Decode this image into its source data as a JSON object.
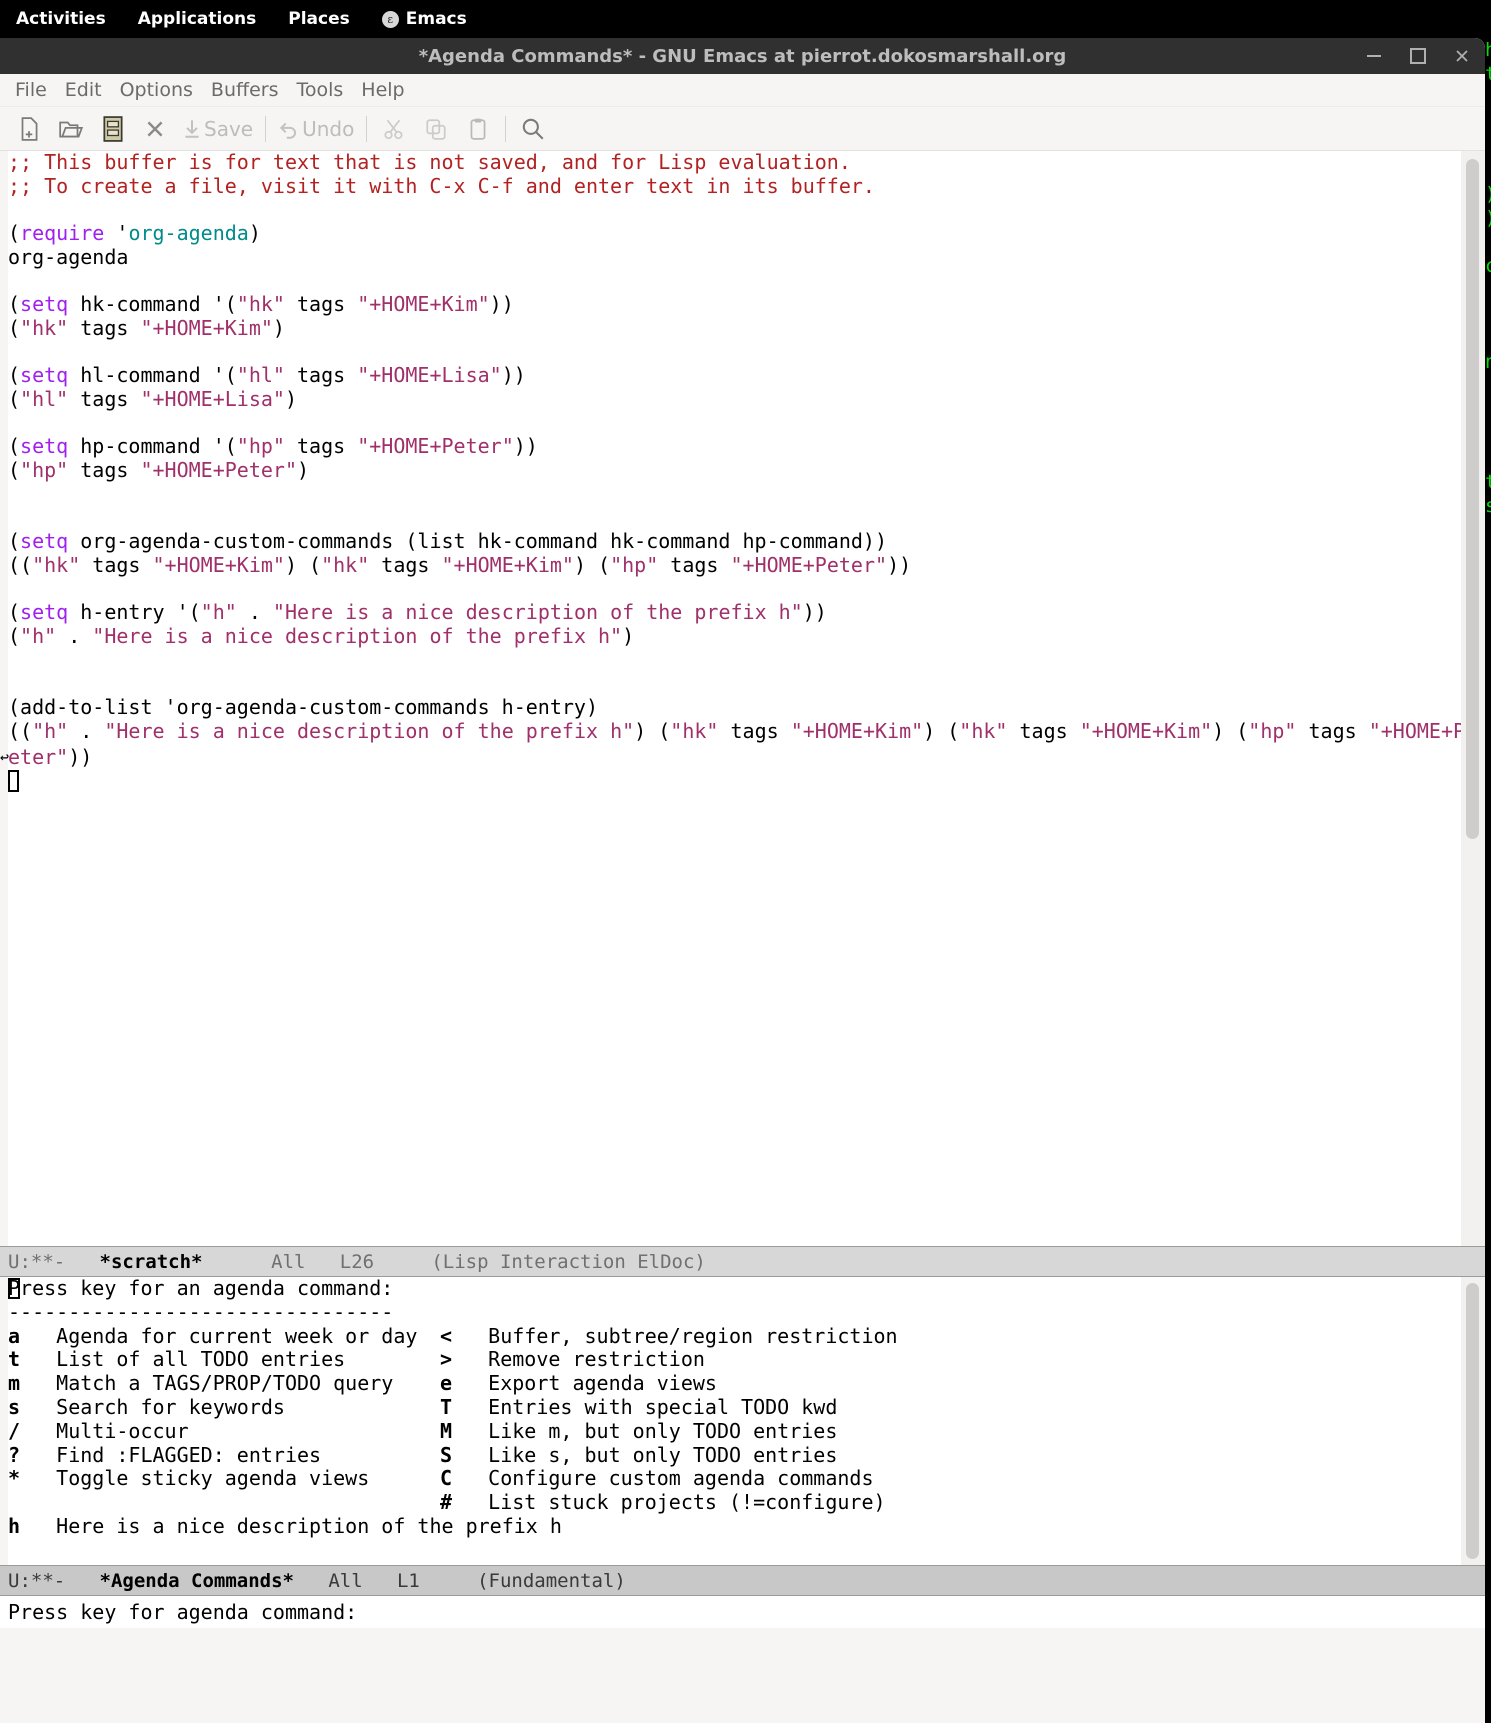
{
  "desktop": {
    "activities": "Activities",
    "applications": "Applications",
    "places": "Places",
    "app_name": "Emacs",
    "app_logo_glyph": "ε"
  },
  "window": {
    "title": "*Agenda Commands* - GNU Emacs at pierrot.dokosmarshall.org",
    "minimize": "—",
    "maximize": "□",
    "close": "✕"
  },
  "menubar": {
    "items": [
      "File",
      "Edit",
      "Options",
      "Buffers",
      "Tools",
      "Help"
    ]
  },
  "toolbar": {
    "new_file": "new-file-icon",
    "open_file": "open-folder-icon",
    "dired": "dired-cabinet-icon",
    "close_buffer": "close-x-icon",
    "save_label": "Save",
    "undo_label": "Undo",
    "cut": "scissors-icon",
    "copy": "copy-icon",
    "paste": "clipboard-icon",
    "search": "magnifier-icon"
  },
  "scratch_buffer": {
    "lines": [
      {
        "segs": [
          {
            "t": ";; This buffer is for text that is not saved, and for Lisp evaluation.",
            "c": "c-comment"
          }
        ]
      },
      {
        "segs": [
          {
            "t": ";; To create a file, visit it with C-x C-f and enter text in its buffer.",
            "c": "c-comment"
          }
        ]
      },
      {
        "segs": []
      },
      {
        "segs": [
          {
            "t": "(",
            "c": "c-plain"
          },
          {
            "t": "require",
            "c": "c-kw"
          },
          {
            "t": " '",
            "c": "c-plain"
          },
          {
            "t": "org-agenda",
            "c": "c-const"
          },
          {
            "t": ")",
            "c": "c-plain"
          }
        ]
      },
      {
        "segs": [
          {
            "t": "org-agenda",
            "c": "c-plain"
          }
        ]
      },
      {
        "segs": []
      },
      {
        "segs": [
          {
            "t": "(",
            "c": "c-plain"
          },
          {
            "t": "setq",
            "c": "c-kw"
          },
          {
            "t": " hk-command '(",
            "c": "c-plain"
          },
          {
            "t": "\"hk\"",
            "c": "c-str"
          },
          {
            "t": " tags ",
            "c": "c-plain"
          },
          {
            "t": "\"+HOME+Kim\"",
            "c": "c-str"
          },
          {
            "t": "))",
            "c": "c-plain"
          }
        ]
      },
      {
        "segs": [
          {
            "t": "(",
            "c": "c-plain"
          },
          {
            "t": "\"hk\"",
            "c": "c-str"
          },
          {
            "t": " tags ",
            "c": "c-plain"
          },
          {
            "t": "\"+HOME+Kim\"",
            "c": "c-str"
          },
          {
            "t": ")",
            "c": "c-plain"
          }
        ]
      },
      {
        "segs": []
      },
      {
        "segs": [
          {
            "t": "(",
            "c": "c-plain"
          },
          {
            "t": "setq",
            "c": "c-kw"
          },
          {
            "t": " hl-command '(",
            "c": "c-plain"
          },
          {
            "t": "\"hl\"",
            "c": "c-str"
          },
          {
            "t": " tags ",
            "c": "c-plain"
          },
          {
            "t": "\"+HOME+Lisa\"",
            "c": "c-str"
          },
          {
            "t": "))",
            "c": "c-plain"
          }
        ]
      },
      {
        "segs": [
          {
            "t": "(",
            "c": "c-plain"
          },
          {
            "t": "\"hl\"",
            "c": "c-str"
          },
          {
            "t": " tags ",
            "c": "c-plain"
          },
          {
            "t": "\"+HOME+Lisa\"",
            "c": "c-str"
          },
          {
            "t": ")",
            "c": "c-plain"
          }
        ]
      },
      {
        "segs": []
      },
      {
        "segs": [
          {
            "t": "(",
            "c": "c-plain"
          },
          {
            "t": "setq",
            "c": "c-kw"
          },
          {
            "t": " hp-command '(",
            "c": "c-plain"
          },
          {
            "t": "\"hp\"",
            "c": "c-str"
          },
          {
            "t": " tags ",
            "c": "c-plain"
          },
          {
            "t": "\"+HOME+Peter\"",
            "c": "c-str"
          },
          {
            "t": "))",
            "c": "c-plain"
          }
        ]
      },
      {
        "segs": [
          {
            "t": "(",
            "c": "c-plain"
          },
          {
            "t": "\"hp\"",
            "c": "c-str"
          },
          {
            "t": " tags ",
            "c": "c-plain"
          },
          {
            "t": "\"+HOME+Peter\"",
            "c": "c-str"
          },
          {
            "t": ")",
            "c": "c-plain"
          }
        ]
      },
      {
        "segs": []
      },
      {
        "segs": []
      },
      {
        "segs": [
          {
            "t": "(",
            "c": "c-plain"
          },
          {
            "t": "setq",
            "c": "c-kw"
          },
          {
            "t": " org-agenda-custom-commands (list hk-command hk-command hp-command))",
            "c": "c-plain"
          }
        ]
      },
      {
        "segs": [
          {
            "t": "((",
            "c": "c-plain"
          },
          {
            "t": "\"hk\"",
            "c": "c-str"
          },
          {
            "t": " tags ",
            "c": "c-plain"
          },
          {
            "t": "\"+HOME+Kim\"",
            "c": "c-str"
          },
          {
            "t": ") (",
            "c": "c-plain"
          },
          {
            "t": "\"hk\"",
            "c": "c-str"
          },
          {
            "t": " tags ",
            "c": "c-plain"
          },
          {
            "t": "\"+HOME+Kim\"",
            "c": "c-str"
          },
          {
            "t": ") (",
            "c": "c-plain"
          },
          {
            "t": "\"hp\"",
            "c": "c-str"
          },
          {
            "t": " tags ",
            "c": "c-plain"
          },
          {
            "t": "\"+HOME+Peter\"",
            "c": "c-str"
          },
          {
            "t": "))",
            "c": "c-plain"
          }
        ]
      },
      {
        "segs": []
      },
      {
        "segs": [
          {
            "t": "(",
            "c": "c-plain"
          },
          {
            "t": "setq",
            "c": "c-kw"
          },
          {
            "t": " h-entry '(",
            "c": "c-plain"
          },
          {
            "t": "\"h\"",
            "c": "c-str"
          },
          {
            "t": " . ",
            "c": "c-plain"
          },
          {
            "t": "\"Here is a nice description of the prefix h\"",
            "c": "c-str"
          },
          {
            "t": "))",
            "c": "c-plain"
          }
        ]
      },
      {
        "segs": [
          {
            "t": "(",
            "c": "c-plain"
          },
          {
            "t": "\"h\"",
            "c": "c-str"
          },
          {
            "t": " . ",
            "c": "c-plain"
          },
          {
            "t": "\"Here is a nice description of the prefix h\"",
            "c": "c-str"
          },
          {
            "t": ")",
            "c": "c-plain"
          }
        ]
      },
      {
        "segs": []
      },
      {
        "segs": []
      },
      {
        "segs": [
          {
            "t": "(add-to-list 'org-agenda-custom-commands h-entry)",
            "c": "c-plain"
          }
        ]
      }
    ],
    "wrapped_line": {
      "head": [
        {
          "t": "((",
          "c": "c-plain"
        },
        {
          "t": "\"h\"",
          "c": "c-str"
        },
        {
          "t": " . ",
          "c": "c-plain"
        },
        {
          "t": "\"Here is a nice description of the prefix h\"",
          "c": "c-str"
        },
        {
          "t": ") (",
          "c": "c-plain"
        },
        {
          "t": "\"hk\"",
          "c": "c-str"
        },
        {
          "t": " tags ",
          "c": "c-plain"
        },
        {
          "t": "\"+HOME+Kim\"",
          "c": "c-str"
        },
        {
          "t": ") (",
          "c": "c-plain"
        },
        {
          "t": "\"hk\"",
          "c": "c-str"
        },
        {
          "t": " tags ",
          "c": "c-plain"
        },
        {
          "t": "\"+HOME+Kim\"",
          "c": "c-str"
        },
        {
          "t": ") (",
          "c": "c-plain"
        },
        {
          "t": "\"hp\"",
          "c": "c-str"
        },
        {
          "t": " tags ",
          "c": "c-plain"
        },
        {
          "t": "\"+HOME+P",
          "c": "c-str"
        }
      ],
      "tail": [
        {
          "t": "eter\"",
          "c": "c-str"
        },
        {
          "t": "))",
          "c": "c-plain"
        }
      ],
      "wrap_glyph": "↩"
    }
  },
  "scratch_modeline": {
    "flags": "U:**-",
    "buffer": "*scratch*",
    "position_all": "All",
    "line": "L26",
    "mode": "(Lisp Interaction ElDoc)"
  },
  "agenda_buffer": {
    "prompt": "Press key for an agenda command:",
    "divider": "--------------------------------",
    "left_commands": [
      {
        "key": "a",
        "desc": "Agenda for current week or day"
      },
      {
        "key": "t",
        "desc": "List of all TODO entries"
      },
      {
        "key": "m",
        "desc": "Match a TAGS/PROP/TODO query"
      },
      {
        "key": "s",
        "desc": "Search for keywords"
      },
      {
        "key": "/",
        "desc": "Multi-occur"
      },
      {
        "key": "?",
        "desc": "Find :FLAGGED: entries"
      },
      {
        "key": "*",
        "desc": "Toggle sticky agenda views"
      }
    ],
    "right_commands": [
      {
        "key": "<",
        "desc": "Buffer, subtree/region restriction"
      },
      {
        "key": ">",
        "desc": "Remove restriction"
      },
      {
        "key": "e",
        "desc": "Export agenda views"
      },
      {
        "key": "T",
        "desc": "Entries with special TODO kwd"
      },
      {
        "key": "M",
        "desc": "Like m, but only TODO entries"
      },
      {
        "key": "S",
        "desc": "Like s, but only TODO entries"
      },
      {
        "key": "C",
        "desc": "Configure custom agenda commands"
      },
      {
        "key": "#",
        "desc": "List stuck projects (!=configure)"
      }
    ],
    "prefix_entry": {
      "key": "h",
      "desc": "Here is a nice description of the prefix h"
    }
  },
  "agenda_modeline": {
    "flags": "U:**-",
    "buffer": "*Agenda Commands*",
    "position_all": "All",
    "line": "L1",
    "mode": "(Fundamental)"
  },
  "echo_area": {
    "message": "Press key for agenda command:"
  },
  "background_terminal": {
    "visible_chars": "h\nt\n\n\n\n\n)\n)\n\nc\n\n\n\nn\n\n\n\n\nt\ns"
  },
  "colors": {
    "gnome_bar_bg": "#000000",
    "titlebar_bg": "#303030",
    "chrome_bg": "#f6f5f4",
    "buffer_bg": "#ffffff",
    "modeline_bg": "#c8c8c8",
    "comment": "#b22222",
    "keyword": "#a020f0",
    "string": "#a0306a",
    "constant": "#008b8b",
    "terminal_green": "#00e000"
  }
}
